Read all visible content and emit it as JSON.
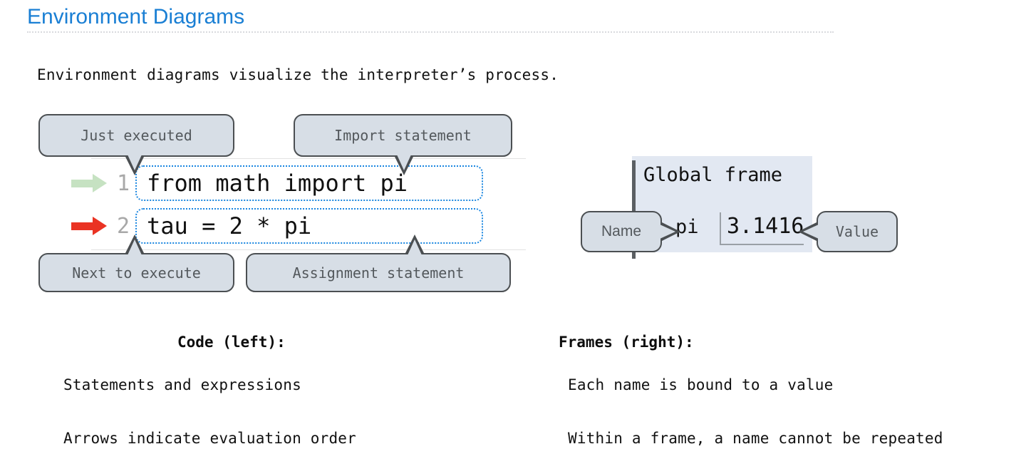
{
  "header": {
    "title": "Environment Diagrams",
    "title_color": "#1a7fd4",
    "rule_color": "#d9dade"
  },
  "intro": {
    "text": "Environment diagrams visualize the interpreter’s process."
  },
  "code_panel": {
    "lines": [
      {
        "number": "1",
        "code": "from math import pi",
        "arrow_icon": "right-arrow-icon",
        "arrow_color": "#c6e2c2",
        "arrow_meaning": "just-executed"
      },
      {
        "number": "2",
        "code": "tau = 2 * pi",
        "arrow_icon": "right-arrow-icon",
        "arrow_color": "#ea3323",
        "arrow_meaning": "next-to-execute"
      }
    ],
    "code_border_color": "#1a86e0"
  },
  "callouts": {
    "just_executed": "Just executed",
    "import_statement": "Import statement",
    "next_to_execute": "Next to execute",
    "assignment_statement": "Assignment statement",
    "name": "Name",
    "value": "Value",
    "fill_color": "#d7dee6",
    "border_color": "#4b4f52",
    "text_color": "#53585c"
  },
  "frame_panel": {
    "title": "Global frame",
    "background_color": "#e2e8f2",
    "bindings": [
      {
        "name": "pi",
        "value": "3.1416"
      }
    ]
  },
  "columns": {
    "left": {
      "heading": "Code (left):",
      "bullets": [
        "Statements and expressions",
        "Arrows indicate evaluation order"
      ]
    },
    "right": {
      "heading": "Frames (right):",
      "bullets": [
        "Each name is bound to a value",
        "Within a frame, a name cannot be repeated"
      ]
    }
  }
}
